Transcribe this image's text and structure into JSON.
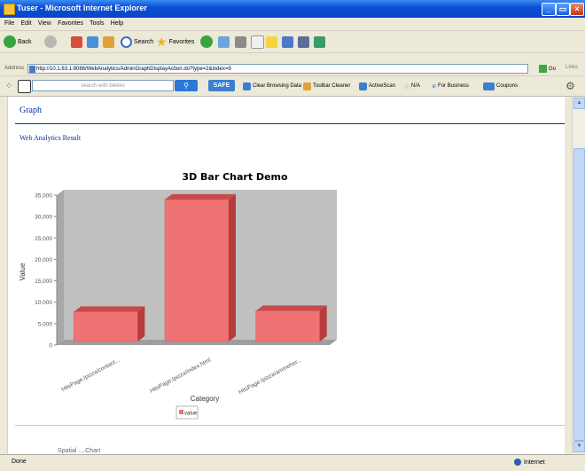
{
  "window": {
    "title": "Tuser - Microsoft Internet Explorer"
  },
  "menu": {
    "items": [
      "File",
      "Edit",
      "View",
      "Favorites",
      "Tools",
      "Help"
    ]
  },
  "toolbar": {
    "back_label": "Back",
    "search_label": "Search",
    "favorites_label": "Favorites"
  },
  "address": {
    "label": "Address",
    "url": "http://10.1.63.1:8086/WebAnalytics/AdminGraphDisplayAction.do?type=2&index=9",
    "go_label": "Go",
    "links_label": "Links"
  },
  "blekko": {
    "search_placeholder": "search with blekko",
    "safe_label": "SAFE",
    "items": [
      "Clear Browsing Data",
      "Toolbar Cleaner",
      "ActiveScan",
      "N/A",
      "For Business",
      "Coupons"
    ]
  },
  "page": {
    "title": "Graph",
    "subtitle": "Web Analytics Result",
    "bottom_cut_text": "Spatial ....Chart"
  },
  "chart_data": {
    "type": "bar",
    "title": "3D Bar Chart Demo",
    "xlabel": "Category",
    "ylabel": "Value",
    "categories": [
      "HitsPage:/pizza/contact...",
      "HitsPage:/pizza/index.html",
      "HitsPage:/pizza/ammeher..."
    ],
    "series": [
      {
        "name": "value",
        "values": [
          7800,
          34000,
          8000
        ]
      }
    ],
    "ylim": [
      0,
      35000
    ],
    "yticks": [
      "0",
      "5,000",
      "10,000",
      "15,000",
      "20,000",
      "25,000",
      "30,000",
      "35,000"
    ],
    "legend_position": "bottom",
    "bar_color": "#f07374",
    "plot_background": "#c0c0c0"
  },
  "status": {
    "left": "Done",
    "zone": "Internet"
  }
}
